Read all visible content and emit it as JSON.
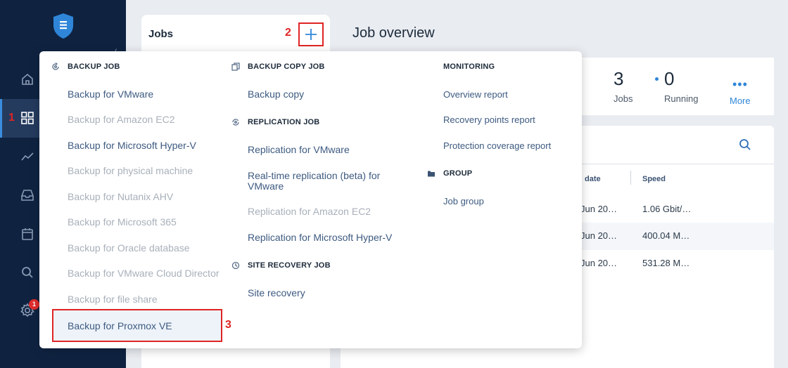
{
  "sidebar": {
    "icons": [
      "shield-logo-icon",
      "home-icon",
      "dashboard-grid-icon",
      "analytics-icon",
      "inbox-icon",
      "calendar-icon",
      "search-icon",
      "settings-icon"
    ],
    "settings_badge": "1",
    "accent": "#3a8dde"
  },
  "jobs_panel": {
    "title": "Jobs"
  },
  "overview": {
    "title": "Job overview",
    "stats": [
      {
        "value": "3",
        "label": "Jobs"
      },
      {
        "value": "0",
        "label": "Running"
      },
      {
        "value": "",
        "label": "More"
      }
    ],
    "table": {
      "headers": [
        "date",
        "Speed"
      ],
      "rows": [
        {
          "date": "Jun 20…",
          "speed": "1.06 Gbit/…"
        },
        {
          "date": "Jun 20…",
          "speed": "400.04 M…"
        },
        {
          "date": "Jun 20…",
          "speed": "531.28 M…"
        }
      ]
    }
  },
  "menu": {
    "backup_job": {
      "title": "BACKUP JOB",
      "items": [
        {
          "label": "Backup for VMware",
          "enabled": true
        },
        {
          "label": "Backup for Amazon EC2",
          "enabled": false
        },
        {
          "label": "Backup for Microsoft Hyper-V",
          "enabled": true
        },
        {
          "label": "Backup for physical machine",
          "enabled": false
        },
        {
          "label": "Backup for Nutanix AHV",
          "enabled": false
        },
        {
          "label": "Backup for Microsoft 365",
          "enabled": false
        },
        {
          "label": "Backup for Oracle database",
          "enabled": false
        },
        {
          "label": "Backup for VMware Cloud Director",
          "enabled": false
        },
        {
          "label": "Backup for file share",
          "enabled": false
        },
        {
          "label": "Backup for Proxmox VE",
          "enabled": true
        }
      ]
    },
    "backup_copy_job": {
      "title": "BACKUP COPY JOB",
      "items": [
        "Backup copy"
      ]
    },
    "replication_job": {
      "title": "REPLICATION JOB",
      "items": [
        {
          "label": "Replication for VMware",
          "enabled": true
        },
        {
          "label": "Real-time replication (beta) for VMware",
          "enabled": true
        },
        {
          "label": "Replication for Amazon EC2",
          "enabled": false
        },
        {
          "label": "Replication for Microsoft Hyper-V",
          "enabled": true
        }
      ]
    },
    "site_recovery_job": {
      "title": "SITE RECOVERY JOB",
      "items": [
        "Site recovery"
      ]
    },
    "monitoring": {
      "title": "MONITORING",
      "items": [
        "Overview report",
        "Recovery points report",
        "Protection coverage report"
      ]
    },
    "group": {
      "title": "GROUP",
      "items": [
        "Job group"
      ]
    }
  },
  "annotations": {
    "step1": "1",
    "step2": "2",
    "step3": "3",
    "color": "#e02424"
  }
}
